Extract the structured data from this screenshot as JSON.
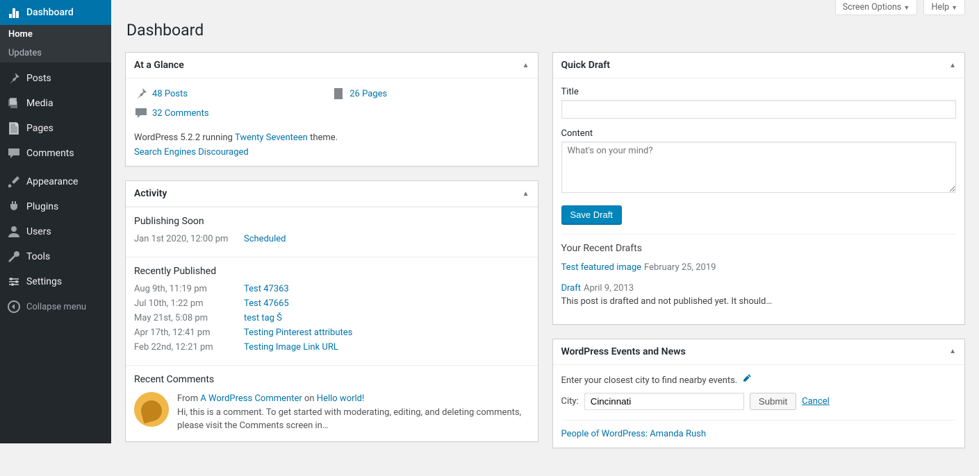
{
  "top_tabs": {
    "screen_options": "Screen Options",
    "help": "Help"
  },
  "page_title": "Dashboard",
  "sidebar": {
    "items": [
      {
        "label": "Dashboard",
        "icon": "dashboard"
      },
      {
        "label": "Posts",
        "icon": "pin"
      },
      {
        "label": "Media",
        "icon": "media"
      },
      {
        "label": "Pages",
        "icon": "page"
      },
      {
        "label": "Comments",
        "icon": "comment"
      },
      {
        "label": "Appearance",
        "icon": "brush"
      },
      {
        "label": "Plugins",
        "icon": "plug"
      },
      {
        "label": "Users",
        "icon": "user"
      },
      {
        "label": "Tools",
        "icon": "wrench"
      },
      {
        "label": "Settings",
        "icon": "settings"
      }
    ],
    "sub": {
      "home": "Home",
      "updates": "Updates"
    },
    "collapse": "Collapse menu"
  },
  "glance": {
    "title": "At a Glance",
    "posts": "48 Posts",
    "pages": "26 Pages",
    "comments": "32 Comments",
    "meta_pre": "WordPress 5.2.2 running ",
    "theme": "Twenty Seventeen",
    "meta_post": " theme.",
    "seo": "Search Engines Discouraged"
  },
  "activity": {
    "title": "Activity",
    "soon_title": "Publishing Soon",
    "soon": [
      {
        "date": "Jan 1st 2020, 12:00 pm",
        "title": "Scheduled"
      }
    ],
    "recent_title": "Recently Published",
    "recent": [
      {
        "date": "Aug 9th, 11:19 pm",
        "title": "Test 47363"
      },
      {
        "date": "Jul 10th, 1:22 pm",
        "title": "Test 47665"
      },
      {
        "date": "May 21st, 5:08 pm",
        "title": "test tag Š"
      },
      {
        "date": "Apr 17th, 12:41 pm",
        "title": "Testing Pinterest attributes"
      },
      {
        "date": "Feb 22nd, 12:21 pm",
        "title": "Testing Image Link URL"
      }
    ],
    "comments_title": "Recent Comments",
    "comment": {
      "from": "From ",
      "author": "A WordPress Commenter",
      "on": " on ",
      "post": "Hello world!",
      "body": "Hi, this is a comment. To get started with moderating, editing, and deleting comments, please visit the Comments screen in…"
    }
  },
  "draft": {
    "title": "Quick Draft",
    "title_label": "Title",
    "content_label": "Content",
    "content_placeholder": "What's on your mind?",
    "save": "Save Draft",
    "recent_title": "Your Recent Drafts",
    "items": [
      {
        "title": "Test featured image",
        "date": "February 25, 2019",
        "excerpt": ""
      },
      {
        "title": "Draft",
        "date": "April 9, 2013",
        "excerpt": "This post is drafted and not published yet. It should…"
      }
    ]
  },
  "events": {
    "title": "WordPress Events and News",
    "prompt": "Enter your closest city to find nearby events.",
    "city_label": "City:",
    "city_value": "Cincinnati",
    "submit": "Submit",
    "cancel": "Cancel",
    "news": "People of WordPress: Amanda Rush"
  }
}
